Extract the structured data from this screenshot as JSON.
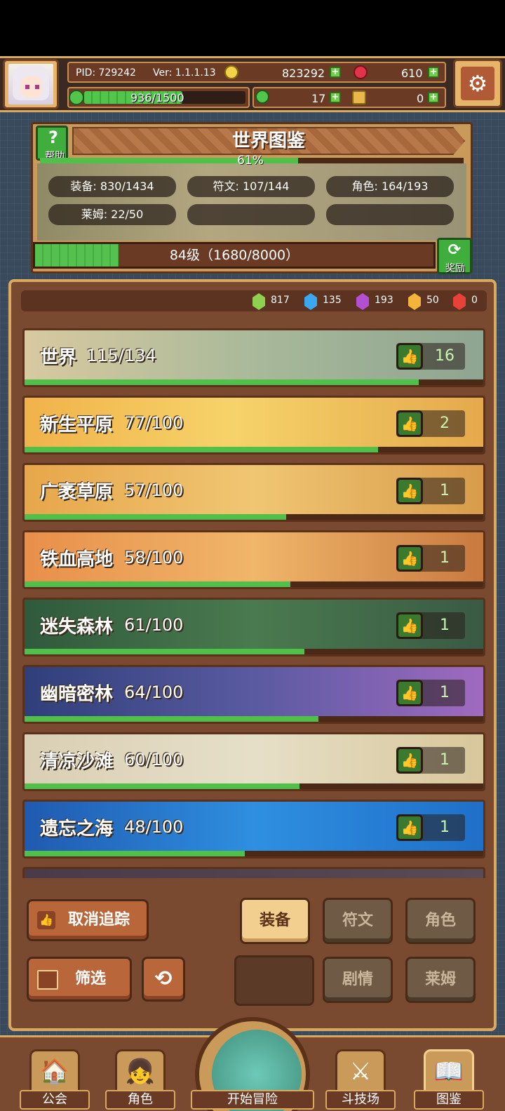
{
  "header": {
    "pid": "PID: 729242",
    "version": "Ver: 1.1.1.13",
    "gold": "823292",
    "ruby": "610",
    "xp": "936/1500",
    "clover": "17",
    "keys": "0"
  },
  "encyclopedia": {
    "title": "世界图鉴",
    "help_label": "帮助",
    "percent": "61%",
    "percent_value": 61,
    "stats": [
      "装备: 830/1434",
      "符文: 107/144",
      "角色: 164/193",
      "莱姆: 22/50"
    ],
    "level_text": "84级（1680/8000）",
    "level_progress": 0.21,
    "reward_label": "奖励"
  },
  "gems": [
    {
      "color": "#8fd14f",
      "value": "817"
    },
    {
      "color": "#3aa7f0",
      "value": "135"
    },
    {
      "color": "#b34fd1",
      "value": "193"
    },
    {
      "color": "#f2b43a",
      "value": "50"
    },
    {
      "color": "#e8413a",
      "value": "0"
    }
  ],
  "regions": [
    {
      "name": "世界",
      "count": "115/134",
      "likes": "16",
      "progress": 0.86,
      "bg": "linear-gradient(90deg,#d8c9a0,#a9b99a 50%,#8ea591)"
    },
    {
      "name": "新生平原",
      "count": "77/100",
      "likes": "2",
      "progress": 0.77,
      "bg": "linear-gradient(90deg,#f1b24a,#f6d36a 45%,#e4a94c)"
    },
    {
      "name": "广袤草原",
      "count": "57/100",
      "likes": "1",
      "progress": 0.57,
      "bg": "linear-gradient(90deg,#e7a64a,#f0c673 50%,#d89c4a)"
    },
    {
      "name": "铁血高地",
      "count": "58/100",
      "likes": "1",
      "progress": 0.58,
      "bg": "linear-gradient(90deg,#e88f4a,#f0b66a 50%,#c97a3f)"
    },
    {
      "name": "迷失森林",
      "count": "61/100",
      "likes": "1",
      "progress": 0.61,
      "bg": "linear-gradient(90deg,#2f5a3c,#4a7a4f 50%,#3a5a44)"
    },
    {
      "name": "幽暗密林",
      "count": "64/100",
      "likes": "1",
      "progress": 0.64,
      "bg": "linear-gradient(90deg,#2f3f7a,#5a5aa0 50%,#a06ac0)"
    },
    {
      "name": "清凉沙滩",
      "count": "60/100",
      "likes": "1",
      "progress": 0.6,
      "bg": "linear-gradient(90deg,#d9cfb4,#e6dfc8 50%,#d8c79a)"
    },
    {
      "name": "遗忘之海",
      "count": "48/100",
      "likes": "1",
      "progress": 0.48,
      "bg": "linear-gradient(90deg,#1f5ab0,#2f8fe0 50%,#1f6fc9)"
    }
  ],
  "controls": {
    "untrack": "取消追踪",
    "filter": "筛选",
    "tabs": [
      "装备",
      "符文",
      "角色",
      "剧情",
      "莱姆"
    ]
  },
  "nav": {
    "guild": "公会",
    "character": "角色",
    "adventure": "开始冒险",
    "arena": "斗技场",
    "encyclopedia": "图鉴"
  }
}
